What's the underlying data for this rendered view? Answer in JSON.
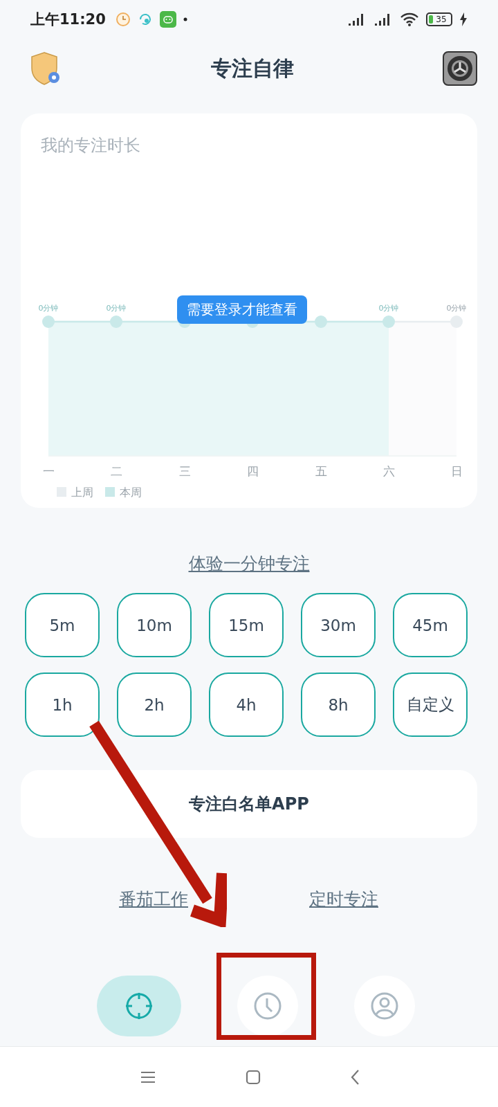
{
  "status_bar": {
    "time": "上午11:20",
    "battery": "35"
  },
  "header": {
    "title": "专注自律"
  },
  "focus_card": {
    "title": "我的专注时长",
    "tooltip": "需要登录才能查看",
    "days": [
      {
        "label": "一",
        "value_label": "0分钟"
      },
      {
        "label": "二",
        "value_label": "0分钟"
      },
      {
        "label": "三"
      },
      {
        "label": "四"
      },
      {
        "label": "五"
      },
      {
        "label": "六",
        "value_label": "0分钟"
      },
      {
        "label": "日",
        "value_label": "0分钟"
      }
    ],
    "legend": [
      {
        "name": "上周",
        "color": "#e8edf0"
      },
      {
        "name": "本周",
        "color": "#c9e9e9"
      }
    ]
  },
  "trial_link": "体验一分钟专注",
  "durations": [
    {
      "label": "5m"
    },
    {
      "label": "10m"
    },
    {
      "label": "15m"
    },
    {
      "label": "30m"
    },
    {
      "label": "45m"
    },
    {
      "label": "1h"
    },
    {
      "label": "2h"
    },
    {
      "label": "4h"
    },
    {
      "label": "8h"
    },
    {
      "label": "自定义"
    }
  ],
  "whitelist_button": "专注白名单APP",
  "mode_links": [
    "番茄工作",
    "定时专注"
  ],
  "bottom_nav": [
    {
      "kind": "focus",
      "selected": true
    },
    {
      "kind": "clock",
      "selected": false
    },
    {
      "kind": "profile",
      "selected": false
    }
  ]
}
